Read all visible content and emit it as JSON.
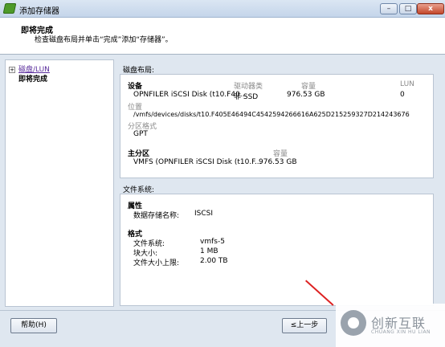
{
  "window": {
    "title": "添加存储器",
    "minimize": "–",
    "maximize": "□",
    "close": "x"
  },
  "header": {
    "title": "即将完成",
    "subtitle": "检查磁盘布局并单击“完成”添加“存储器”。"
  },
  "nav": {
    "expander": "+",
    "items": [
      {
        "label": "磁盘/LUN"
      },
      {
        "label": "即将完成"
      }
    ]
  },
  "disk_layout": {
    "section_label": "磁盘布局:",
    "device_header": "设备",
    "drive_type_header": "驱动器类",
    "capacity_header": "容量",
    "lun_header": "LUN",
    "device_name": "OPNFILER iSCSI Disk (t10.F40...",
    "drive_type": "非 SSD",
    "capacity": "976.53 GB",
    "lun": "0",
    "location_label": "位置",
    "location_value": "/vmfs/devices/disks/t10.F405E46494C4542594266616A625D215259327D214243676",
    "partition_format_label": "分区格式",
    "partition_format_value": "GPT",
    "primary_partition_header": "主分区",
    "primary_capacity_header": "容量",
    "primary_partition_name": "VMFS (OPNFILER iSCSI Disk (t10.F...",
    "primary_capacity": "976.53 GB"
  },
  "filesystem": {
    "section_label": "文件系统:",
    "properties_header": "属性",
    "datastore_name_label": "数据存储名称:",
    "datastore_name_value": "ISCSI",
    "format_header": "格式",
    "fs_label": "文件系统:",
    "fs_value": "vmfs-5",
    "block_size_label": "块大小:",
    "block_size_value": "1 MB",
    "max_file_size_label": "文件大小上限:",
    "max_file_size_value": "2.00 TB"
  },
  "footer": {
    "help_button": "帮助(H)",
    "back_button": "≤上一步"
  },
  "watermark": {
    "cn": "创新互联",
    "en": "CHUANG XIN HU LIAN"
  }
}
